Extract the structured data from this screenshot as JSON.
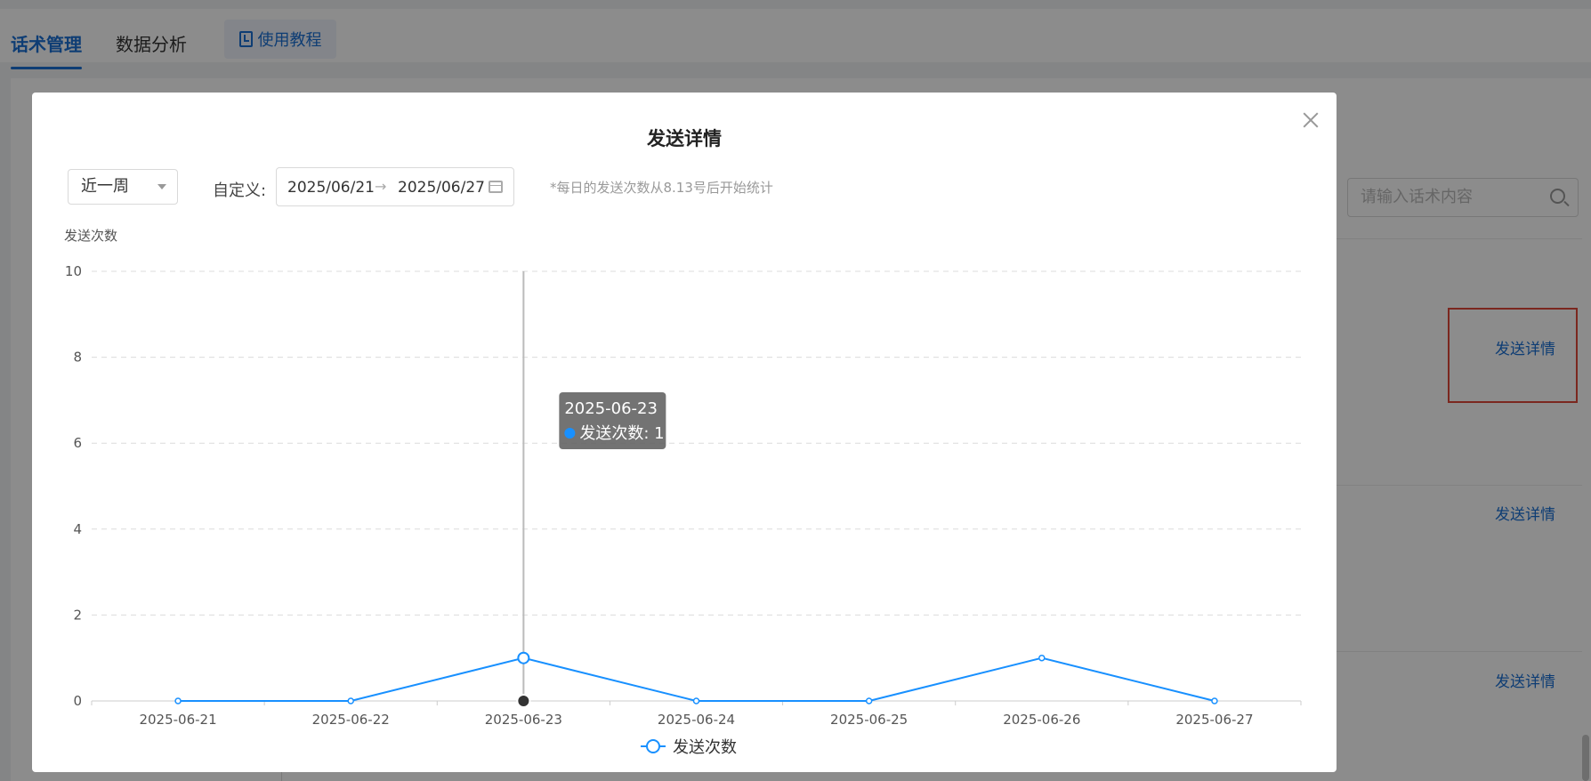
{
  "top_tabs": [
    {
      "label": "话术管理",
      "active": true
    },
    {
      "label": "数据分析",
      "active": false
    }
  ],
  "tutorial_button": {
    "label": "使用教程",
    "icon": "book-icon"
  },
  "background": {
    "search_placeholder": "请输入话术内容",
    "detail_links": [
      "发送详情",
      "发送详情",
      "发送详情"
    ]
  },
  "modal": {
    "title": "发送详情",
    "period_select": {
      "value": "近一周"
    },
    "custom_label": "自定义:",
    "date_range": {
      "start": "2025/06/21",
      "arrow": "→",
      "end": "2025/06/27"
    },
    "note": "*每日的发送次数从8.13号后开始统计"
  },
  "chart_data": {
    "type": "line",
    "ylabel": "发送次数",
    "ylim": [
      0,
      10
    ],
    "yticks": [
      0,
      2,
      4,
      6,
      8,
      10
    ],
    "categories": [
      "2025-06-21",
      "2025-06-22",
      "2025-06-23",
      "2025-06-24",
      "2025-06-25",
      "2025-06-26",
      "2025-06-27"
    ],
    "series": [
      {
        "name": "发送次数",
        "values": [
          0,
          0,
          1,
          0,
          0,
          1,
          0
        ],
        "color": "#1890ff"
      }
    ],
    "grid": true,
    "legend": "bottom-center",
    "tooltip": {
      "category": "2025-06-23",
      "label": "发送次数",
      "value": 1
    }
  },
  "colors": {
    "accent": "#1a6fd4",
    "line": "#1890ff",
    "highlight": "#e0473a"
  }
}
